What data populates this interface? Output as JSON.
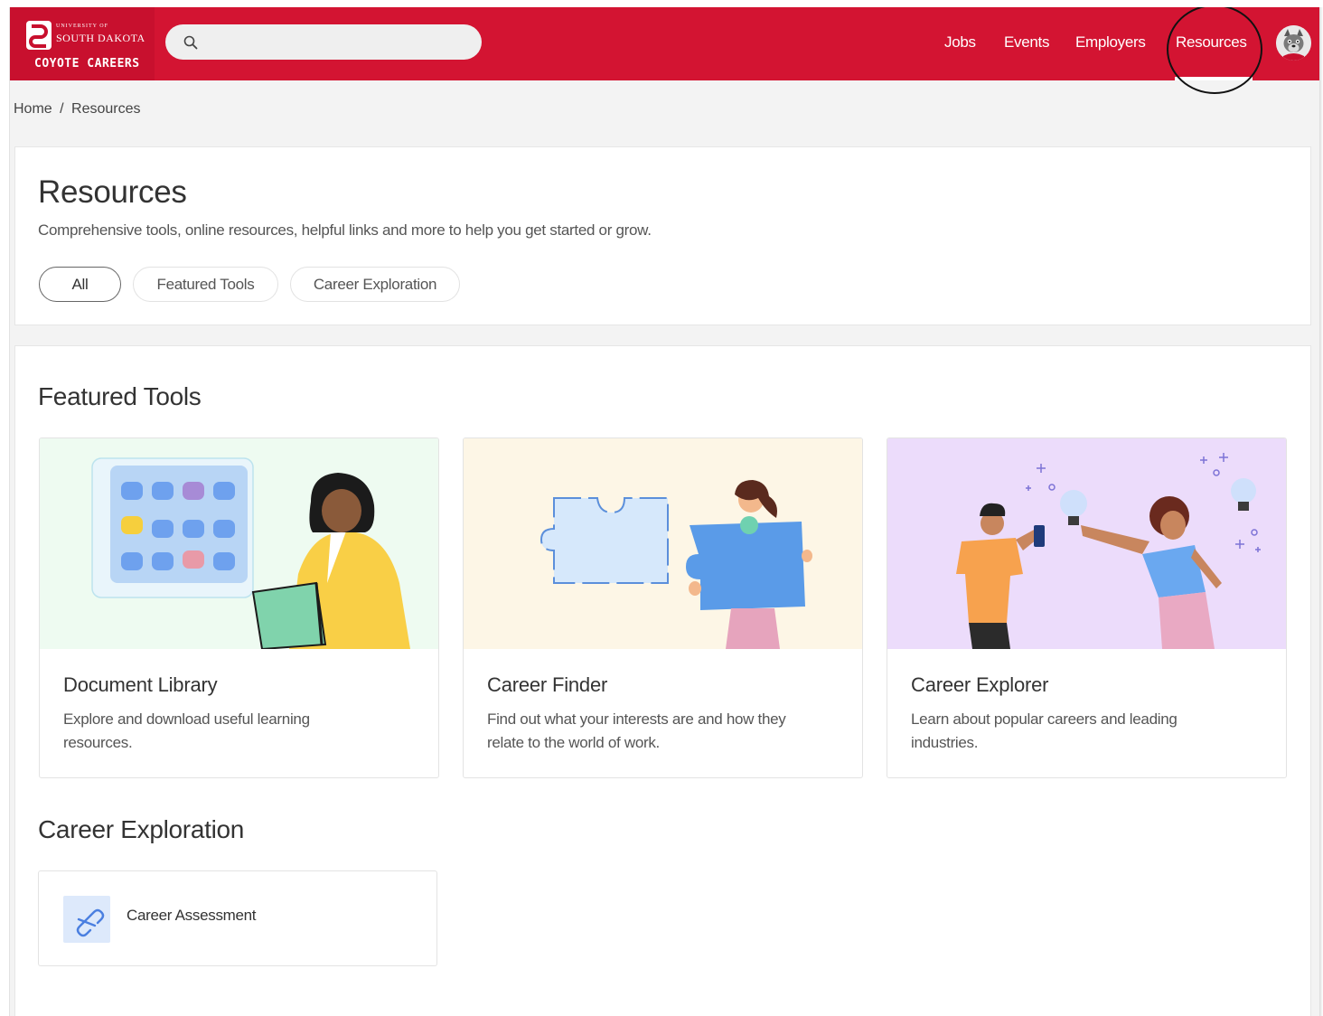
{
  "brand": {
    "university_small": "UNIVERSITY OF",
    "university_name": "SOUTH DAKOTA",
    "program": "COYOTE CAREERS",
    "brand_color": "#d31432"
  },
  "search": {
    "placeholder": "",
    "value": "",
    "icon": "search-icon"
  },
  "nav": {
    "items": [
      {
        "label": "Jobs"
      },
      {
        "label": "Events"
      },
      {
        "label": "Employers"
      },
      {
        "label": "Resources",
        "active": true
      }
    ],
    "avatar": "coyote-mascot-avatar"
  },
  "breadcrumb": {
    "home": "Home",
    "separator": "/",
    "current": "Resources"
  },
  "intro": {
    "title": "Resources",
    "subtitle": "Comprehensive tools, online resources, helpful links and more to help you get started or grow.",
    "filters": [
      {
        "label": "All",
        "active": true
      },
      {
        "label": "Featured Tools"
      },
      {
        "label": "Career Exploration"
      }
    ]
  },
  "featured": {
    "heading": "Featured Tools",
    "cards": [
      {
        "title": "Document Library",
        "description": "Explore and download useful learning resources.",
        "bg": "#eefbf1"
      },
      {
        "title": "Career Finder",
        "description": "Find out what your interests are and how they relate to the world of work.",
        "bg": "#fdf6e6"
      },
      {
        "title": "Career Explorer",
        "description": "Learn about popular careers and leading industries.",
        "bg": "#ecdcfb"
      }
    ]
  },
  "exploration": {
    "heading": "Career Exploration",
    "items": [
      {
        "label": "Career Assessment",
        "icon": "link-icon"
      }
    ]
  }
}
